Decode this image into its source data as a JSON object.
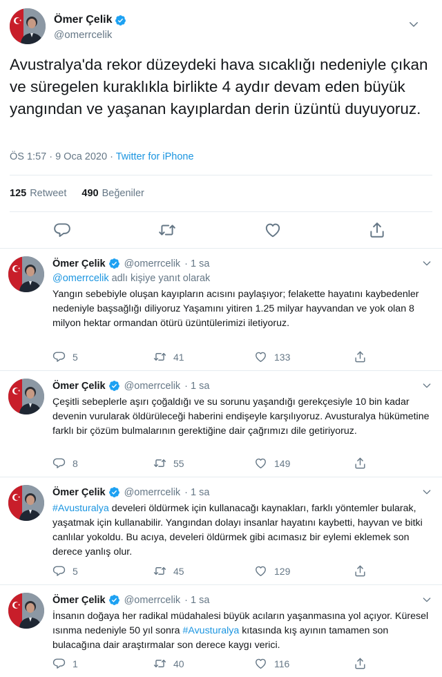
{
  "main": {
    "author_name": "Ömer Çelik",
    "author_handle": "@omerrcelik",
    "text": "Avustralya'da rekor düzeydeki hava sıcaklığı nedeniyle çıkan ve süregelen kuraklıkla birlikte 4 aydır devam eden büyük yangından ve yaşanan kayıplardan derin üzüntü duyuyoruz.",
    "timestamp": "ÖS 1:57 · 9 Oca 2020 · ",
    "source": "Twitter for iPhone",
    "retweet_count": "125",
    "retweet_label": "Retweet",
    "like_count": "490",
    "like_label": "Beğeniler"
  },
  "replies": [
    {
      "author_name": "Ömer Çelik",
      "author_handle": "@omerrcelik",
      "time": "· 1 sa",
      "reply_to_handle": "@omerrcelik",
      "reply_to_suffix": " adlı kişiye yanıt olarak",
      "text": "Yangın sebebiyle oluşan kayıpların acısını paylaşıyor; felakette hayatını kaybedenler nedeniyle başsağlığı diliyoruz Yaşamını yitiren 1.25 milyar hayvandan ve  yok olan 8 milyon hektar ormandan ötürü üzüntülerimizi iletiyoruz.",
      "reply_count": "5",
      "retweet_count": "41",
      "like_count": "133"
    },
    {
      "author_name": "Ömer Çelik",
      "author_handle": "@omerrcelik",
      "time": "· 1 sa",
      "text": "Çeşitli sebeplerle aşırı çoğaldığı ve su sorunu yaşandığı gerekçesiyle 10 bin kadar devenin vurularak öldürüleceği haberini endişeyle karşılıyoruz. Avusturalya hükümetine farklı bir çözüm bulmalarının gerektiğine dair çağrımızı dile getiriyoruz.",
      "reply_count": "8",
      "retweet_count": "55",
      "like_count": "149"
    },
    {
      "author_name": "Ömer Çelik",
      "author_handle": "@omerrcelik",
      "time": "· 1 sa",
      "hashtag": "#Avusturalya",
      "text": " develeri öldürmek için kullanacağı kaynakları, farklı yöntemler bularak, yaşatmak için kullanabilir. Yangından dolayı insanlar hayatını kaybetti, hayvan ve bitki canlılar yokoldu. Bu acıya, develeri öldürmek gibi acımasız bir eylemi eklemek son derece yanlış olur.",
      "reply_count": "5",
      "retweet_count": "45",
      "like_count": "129"
    },
    {
      "author_name": "Ömer Çelik",
      "author_handle": "@omerrcelik",
      "time": "· 1 sa",
      "text_before": "İnsanın doğaya her radikal müdahalesi büyük acıların yaşanmasına yol açıyor. Küresel ısınma nedeniyle 50 yıl sonra ",
      "hashtag": "#Avusturalya",
      "text_after": " kıtasında kış ayının tamamen son bulacağına dair araştırmalar son derece kaygı verici.",
      "reply_count": "1",
      "retweet_count": "40",
      "like_count": "116"
    }
  ],
  "icons": {
    "verified": "verified-badge-icon",
    "chevron": "chevron-down-icon",
    "reply": "reply-icon",
    "retweet": "retweet-icon",
    "like": "heart-icon",
    "share": "share-icon"
  },
  "colors": {
    "link": "#1b95e0",
    "muted": "#657786",
    "text": "#14171a",
    "border": "#e6ecf0"
  }
}
